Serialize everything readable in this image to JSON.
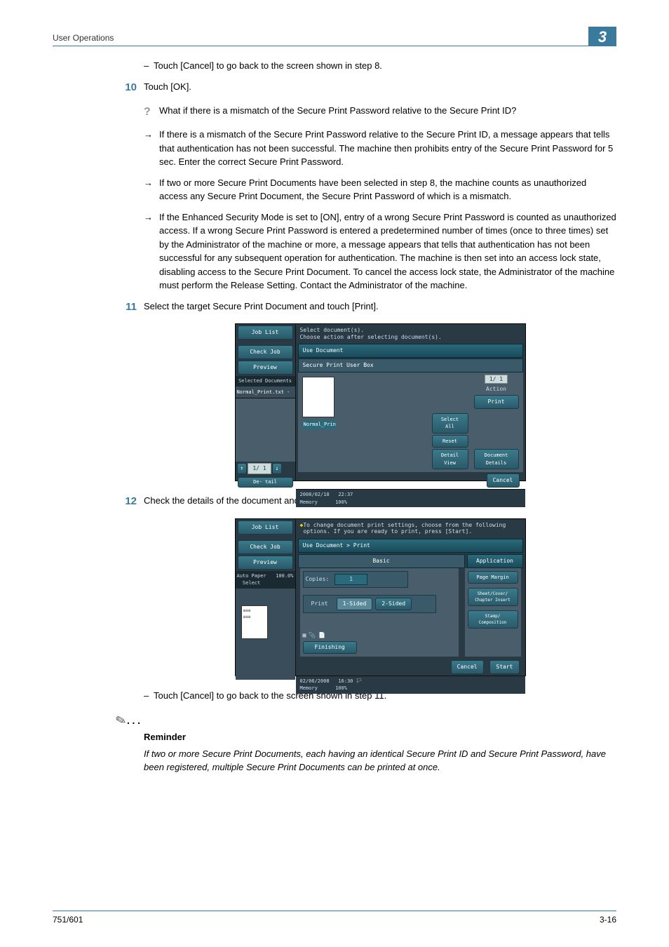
{
  "header": {
    "title": "User Operations",
    "chapter": "3"
  },
  "step9_dash": "Touch [Cancel] to go back to the screen shown in step 8.",
  "step10": {
    "num": "10",
    "text": "Touch [OK].",
    "question": "What if there is a mismatch of the Secure Print Password relative to the Secure Print ID?",
    "bullets": [
      "If there is a mismatch of the Secure Print Password relative to the Secure Print ID, a message appears that tells that authentication has not been successful. The machine then prohibits entry of the Secure Print Password for 5 sec. Enter the correct Secure Print Password.",
      "If two or more Secure Print Documents have been selected in step 8, the machine counts as unauthorized access any Secure Print Document, the Secure Print Password of which is a mismatch.",
      "If the Enhanced Security Mode is set to [ON], entry of a wrong Secure Print Password is counted as unauthorized access. If a wrong Secure Print Password is entered a predetermined number of times (once to three times) set by the Administrator of the machine or more, a message appears that tells that authentication has not been successful for any subsequent operation for authentication. The machine is then set into an access lock state, disabling access to the Secure Print Document. To cancel the access lock state, the Administrator of the machine must perform the Release Setting. Contact the Administrator of the machine."
    ]
  },
  "step11": {
    "num": "11",
    "text": "Select the target Secure Print Document and touch [Print]."
  },
  "step12": {
    "num": "12",
    "text": "Check the details of the document and press the [Start] key or touch [Start].",
    "dash": "Touch [Cancel] to go back to the screen shown in step 11."
  },
  "reminder": {
    "title": "Reminder",
    "body": "If two or more Secure Print Documents, each having an identical Secure Print ID and Secure Print Password, have been registered, multiple Secure Print Documents can be printed at once."
  },
  "footer": {
    "left": "751/601",
    "right": "3-16"
  },
  "screen1": {
    "sidebar": {
      "job_list": "Job List",
      "check_job": "Check Job",
      "preview": "Preview",
      "selected_docs": "Selected Documents",
      "doc_item": "Normal_Print.txt -",
      "pager": "1/  1",
      "detail": "De-\ntail"
    },
    "title_line1": "Select document(s).",
    "title_line2": "Choose action after selecting document(s).",
    "bar1": "Use Document",
    "bar2": "Secure Print User Box",
    "thumb_label": "Normal_Prin",
    "pager_main": "1/   1",
    "action": "Action",
    "print": "Print",
    "select_all": "Select\nAll",
    "reset": "Reset",
    "detail_view": "Detail\nView",
    "document_details": "Document\nDetails",
    "cancel": "Cancel",
    "footer_date": "2008/02/18",
    "footer_time": "22:37",
    "footer_mem": "Memory",
    "footer_pct": "100%"
  },
  "screen2": {
    "sidebar": {
      "job_list": "Job List",
      "check_job": "Check Job",
      "preview": "Preview",
      "auto_paper": "Auto Paper\nSelect",
      "zoom": "100.0%"
    },
    "title": "To change document print settings, choose from the following options. If you are ready to print, press [Start].",
    "bar": "Use Document > Print",
    "basic": "Basic",
    "application": "Application",
    "copies": "Copies:",
    "copies_val": "1",
    "print": "Print",
    "one_sided": "1-Sided",
    "two_sided": "2-Sided",
    "finishing": "Finishing",
    "page_margin": "Page Margin",
    "sheet_cover": "Sheet/Cover/\nChapter Insert",
    "stamp": "Stamp/\nComposition",
    "cancel": "Cancel",
    "start": "Start",
    "footer_date": "02/06/2008",
    "footer_time": "16:30",
    "footer_mem": "Memory",
    "footer_pct": "100%"
  }
}
